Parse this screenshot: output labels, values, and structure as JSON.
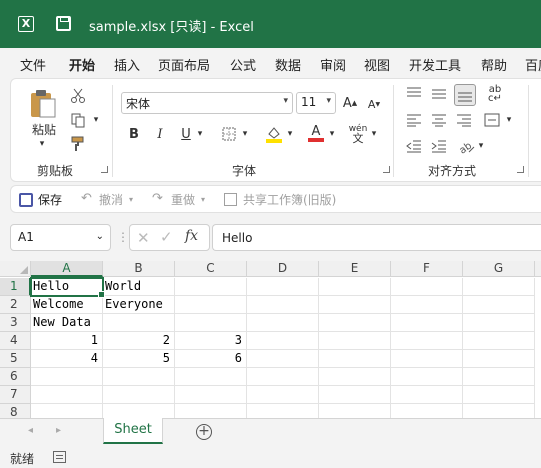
{
  "window": {
    "app_icon": "excel-logo-icon",
    "title": "sample.xlsx  [只读]  -  Excel"
  },
  "menu": {
    "tabs": [
      "文件",
      "开始",
      "插入",
      "页面布局",
      "公式",
      "数据",
      "审阅",
      "视图",
      "开发工具",
      "帮助",
      "百度"
    ],
    "active": "开始"
  },
  "ribbon": {
    "clipboard": {
      "paste_label": "粘贴",
      "group_label": "剪贴板"
    },
    "font": {
      "name": "宋体",
      "size": "11",
      "bold": "B",
      "italic": "I",
      "underline": "U",
      "group_label": "字体",
      "font_color": "#e03030",
      "fill_color": "#ffe100"
    },
    "alignment": {
      "group_label": "对齐方式"
    }
  },
  "qat": {
    "save": "保存",
    "undo": "撤消",
    "redo": "重做",
    "share": "共享工作簿(旧版)"
  },
  "formula_bar": {
    "name_box": "A1",
    "fx": "fx",
    "content": "Hello"
  },
  "grid": {
    "columns": [
      "A",
      "B",
      "C",
      "D",
      "E",
      "F",
      "G"
    ],
    "rows": [
      "1",
      "2",
      "3",
      "4",
      "5",
      "6",
      "7",
      "8"
    ],
    "cells": {
      "A1": "Hello",
      "B1": "World",
      "A2": "Welcome",
      "B2": "Everyone",
      "A3": "New Data",
      "A4": "1",
      "B4": "2",
      "C4": "3",
      "A5": "4",
      "B5": "5",
      "C5": "6"
    },
    "selected": "A1"
  },
  "sheets": {
    "tabs": [
      "Sheet"
    ],
    "active": "Sheet"
  },
  "status": {
    "text": "就绪"
  },
  "colors": {
    "accent": "#217346"
  }
}
